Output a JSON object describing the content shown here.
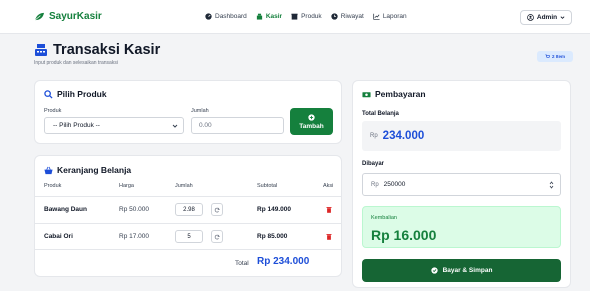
{
  "nav": {
    "brand": "SayurKasir",
    "items": [
      {
        "label": "Dashboard",
        "icon": "dashboard-icon",
        "active": false
      },
      {
        "label": "Kasir",
        "icon": "cashier-icon",
        "active": true
      },
      {
        "label": "Produk",
        "icon": "box-icon",
        "active": false
      },
      {
        "label": "Riwayat",
        "icon": "clock-icon",
        "active": false
      },
      {
        "label": "Laporan",
        "icon": "chart-icon",
        "active": false
      }
    ],
    "admin": "Admin"
  },
  "header": {
    "title": "Transaksi Kasir",
    "subtitle": "Input produk dan selesaikan transaksi",
    "item_badge": "2 Item"
  },
  "pilih": {
    "title": "Pilih Produk",
    "produk_label": "Produk",
    "produk_value": "-- Pilih Produk --",
    "jumlah_label": "Jumlah",
    "jumlah_placeholder": "0.00",
    "tambah_label": "Tambah"
  },
  "keranjang": {
    "title": "Keranjang Belanja",
    "columns": [
      "Produk",
      "Harga",
      "Jumlah",
      "Subtotal",
      "Aksi"
    ],
    "rows": [
      {
        "produk": "Bawang Daun",
        "harga": "Rp 50.000",
        "jumlah": "2.98",
        "subtotal": "Rp 149.000"
      },
      {
        "produk": "Cabai Ori",
        "harga": "Rp 17.000",
        "jumlah": "5",
        "subtotal": "Rp 85.000"
      }
    ],
    "total_label": "Total",
    "total_value": "Rp 234.000"
  },
  "pembayaran": {
    "title": "Pembayaran",
    "total_label": "Total Belanja",
    "rp": "Rp",
    "total_value": "234.000",
    "dibayar_label": "Dibayar",
    "dibayar_value": "250000",
    "kembalian_label": "Kembalian",
    "kembalian_value": "Rp 16.000",
    "bayar_label": "Bayar & Simpan"
  },
  "colors": {
    "brand_green": "#15803d",
    "accent_blue": "#1d4ed8",
    "danger_red": "#dc2626"
  }
}
